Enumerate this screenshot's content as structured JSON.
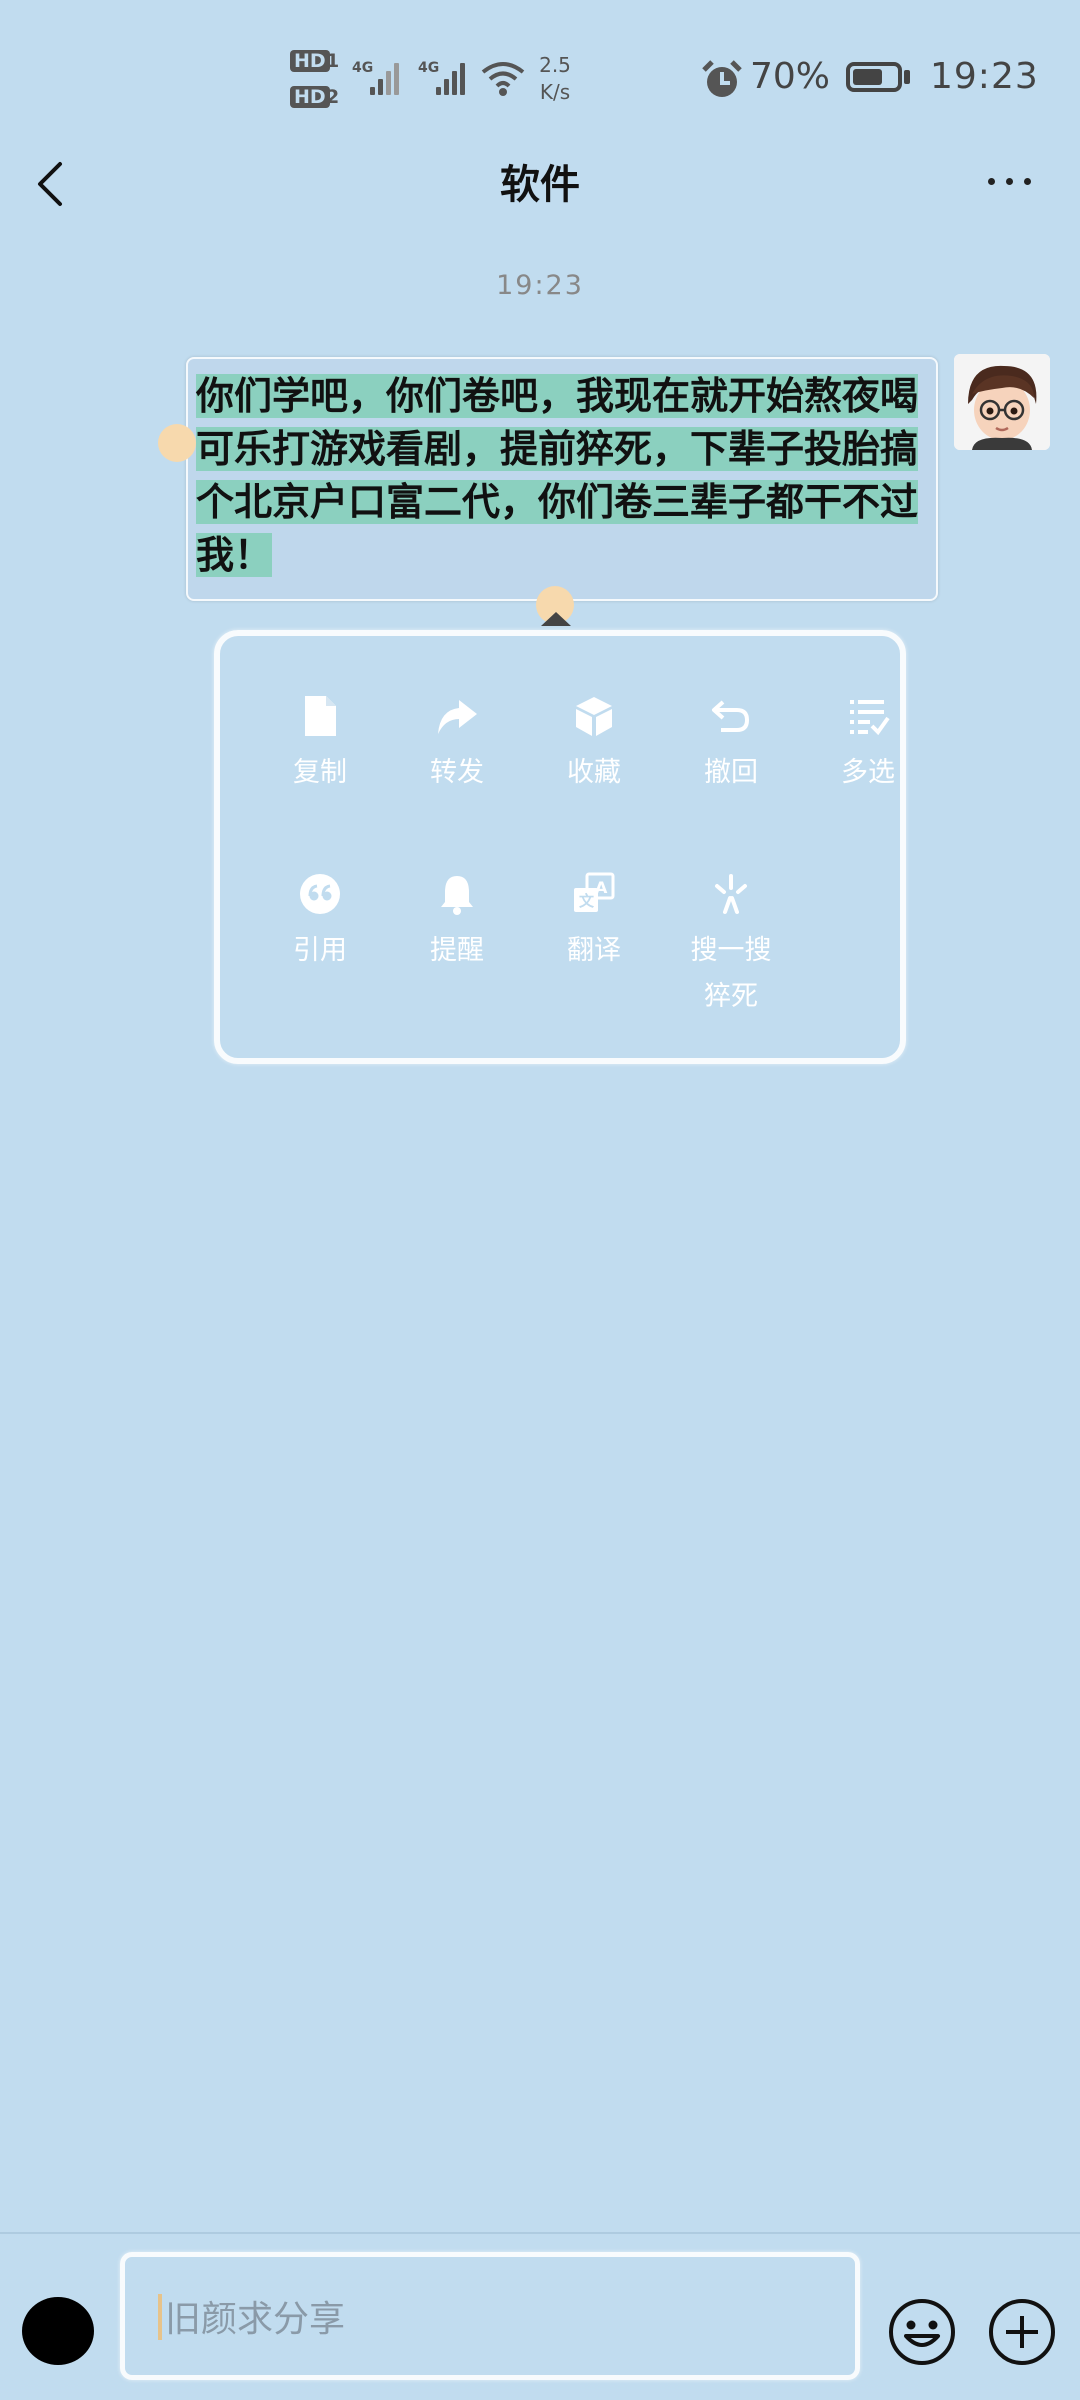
{
  "status_bar": {
    "sim1_label": "HD",
    "sim1_index": "1",
    "sim2_label": "HD",
    "sim2_index": "2",
    "net1": "4G",
    "net2": "4G",
    "speed_value": "2.5",
    "speed_unit": "K/s",
    "battery_percent": "70%",
    "battery_level": 0.7,
    "time": "19:23"
  },
  "header": {
    "title": "软件"
  },
  "chat": {
    "time_divider": "19:23",
    "message": {
      "text_selected": "你们学吧，你们卷吧，我现在就开始熬夜喝可乐打游戏看剧，提前猝死，下辈子投胎搞个北京户口富二代，你们卷三辈子都干不过我！"
    }
  },
  "context_menu": {
    "items": [
      {
        "label": "复制",
        "icon": "copy-icon"
      },
      {
        "label": "转发",
        "icon": "forward-icon"
      },
      {
        "label": "收藏",
        "icon": "favorite-icon"
      },
      {
        "label": "撤回",
        "icon": "recall-icon"
      },
      {
        "label": "多选",
        "icon": "multiselect-icon"
      },
      {
        "label": "引用",
        "icon": "quote-icon"
      },
      {
        "label": "提醒",
        "icon": "bell-icon"
      },
      {
        "label": "翻译",
        "icon": "translate-icon"
      },
      {
        "label": "搜一搜",
        "sublabel": "猝死",
        "icon": "search-spark-icon"
      }
    ]
  },
  "input_bar": {
    "placeholder": "旧颜求分享"
  },
  "colors": {
    "background": "#c1dcef",
    "selection_highlight": "#8bd0bf",
    "selection_handle": "#f7d9ad"
  }
}
